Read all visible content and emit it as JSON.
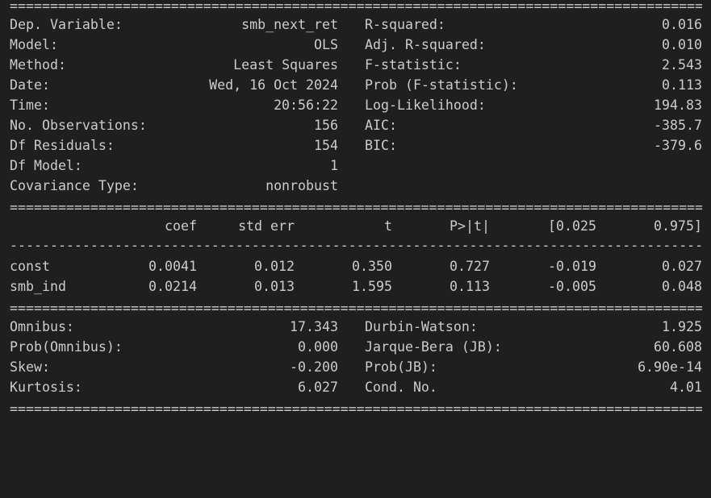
{
  "rule_char": "=",
  "dash_char": "-",
  "top": [
    {
      "l1": "Dep. Variable:",
      "v1": "smb_next_ret",
      "l2": "R-squared:",
      "v2": "0.016"
    },
    {
      "l1": "Model:",
      "v1": "OLS",
      "l2": "Adj. R-squared:",
      "v2": "0.010"
    },
    {
      "l1": "Method:",
      "v1": "Least Squares",
      "l2": "F-statistic:",
      "v2": "2.543"
    },
    {
      "l1": "Date:",
      "v1": "Wed, 16 Oct 2024",
      "l2": "Prob (F-statistic):",
      "v2": "0.113"
    },
    {
      "l1": "Time:",
      "v1": "20:56:22",
      "l2": "Log-Likelihood:",
      "v2": "194.83"
    },
    {
      "l1": "No. Observations:",
      "v1": "156",
      "l2": "AIC:",
      "v2": "-385.7"
    },
    {
      "l1": "Df Residuals:",
      "v1": "154",
      "l2": "BIC:",
      "v2": "-379.6"
    },
    {
      "l1": "Df Model:",
      "v1": "1",
      "l2": "",
      "v2": ""
    },
    {
      "l1": "Covariance Type:",
      "v1": "nonrobust",
      "l2": "",
      "v2": ""
    }
  ],
  "coef_header": {
    "coef": "coef",
    "std": "std err",
    "t": "t",
    "p": "P>|t|",
    "lo": "[0.025",
    "hi": "0.975]"
  },
  "coef_rows": [
    {
      "name": "const",
      "coef": "0.0041",
      "std": "0.012",
      "t": "0.350",
      "p": "0.727",
      "lo": "-0.019",
      "hi": "0.027"
    },
    {
      "name": "smb_ind",
      "coef": "0.0214",
      "std": "0.013",
      "t": "1.595",
      "p": "0.113",
      "lo": "-0.005",
      "hi": "0.048"
    }
  ],
  "bottom": [
    {
      "l1": "Omnibus:",
      "v1": "17.343",
      "l2": "Durbin-Watson:",
      "v2": "1.925"
    },
    {
      "l1": "Prob(Omnibus):",
      "v1": "0.000",
      "l2": "Jarque-Bera (JB):",
      "v2": "60.608"
    },
    {
      "l1": "Skew:",
      "v1": "-0.200",
      "l2": "Prob(JB):",
      "v2": "6.90e-14"
    },
    {
      "l1": "Kurtosis:",
      "v1": "6.027",
      "l2": "Cond. No.",
      "v2": "4.01"
    }
  ]
}
